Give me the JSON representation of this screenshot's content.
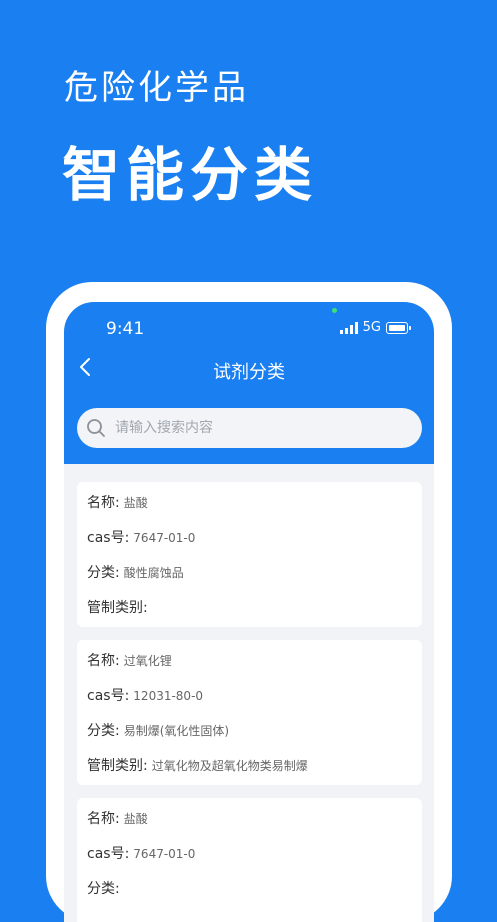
{
  "promo": {
    "subtitle": "危险化学品",
    "title": "智能分类"
  },
  "status_bar": {
    "time": "9:41",
    "network": "5G"
  },
  "nav": {
    "title": "试剂分类"
  },
  "search": {
    "placeholder": "请输入搜索内容"
  },
  "labels": {
    "name": "名称:",
    "cas": "cas号:",
    "category": "分类:",
    "control": "管制类别:"
  },
  "cards": [
    {
      "name": "盐酸",
      "cas": "7647-01-0",
      "category": "酸性腐蚀品",
      "control": ""
    },
    {
      "name": "过氧化锂",
      "cas": "12031-80-0",
      "category": "易制爆(氧化性固体)",
      "control": "过氧化物及超氧化物类易制爆"
    },
    {
      "name": "盐酸",
      "cas": "7647-01-0",
      "category": "",
      "control": ""
    }
  ],
  "icons": {
    "back": "chevron-left-icon",
    "search": "search-icon",
    "signal": "signal-icon",
    "battery": "battery-icon"
  },
  "colors": {
    "brand_blue": "#1a7ff0",
    "page_gray": "#f1f3f6",
    "card_white": "#ffffff"
  }
}
